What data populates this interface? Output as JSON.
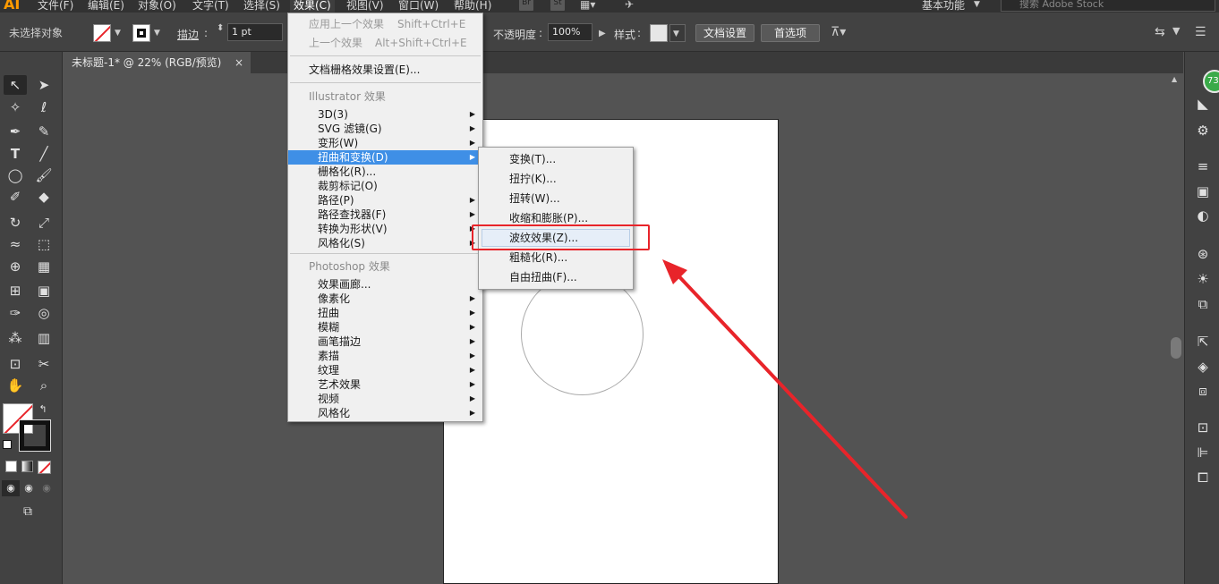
{
  "menubar": {
    "logo": "AI",
    "items": [
      "文件(F)",
      "编辑(E)",
      "对象(O)",
      "文字(T)",
      "选择(S)",
      "效果(C)",
      "视图(V)",
      "窗口(W)",
      "帮助(H)"
    ],
    "br": "Br",
    "st": "St",
    "workspace": "基本功能",
    "search_placeholder": "搜索 Adobe Stock"
  },
  "controlbar": {
    "selection_status": "未选择对象",
    "stroke_label": "描边",
    "stroke_value": "1 pt",
    "opacity_label": "不透明度",
    "opacity_value": "100%",
    "style_label": "样式",
    "doc_setup": "文档设置",
    "preferences": "首选项"
  },
  "tab": {
    "title": "未标题-1* @ 22% (RGB/预览)",
    "close": "×"
  },
  "effects_menu": {
    "apply_last": "应用上一个效果",
    "apply_last_shortcut": "Shift+Ctrl+E",
    "last_effect": "上一个效果",
    "last_effect_shortcut": "Alt+Shift+Ctrl+E",
    "raster_settings": "文档栅格效果设置(E)...",
    "illustrator_header": "Illustrator 效果",
    "illustrator_items": [
      "3D(3)",
      "SVG 滤镜(G)",
      "变形(W)",
      "扭曲和变换(D)",
      "栅格化(R)...",
      "裁剪标记(O)",
      "路径(P)",
      "路径查找器(F)",
      "转换为形状(V)",
      "风格化(S)"
    ],
    "photoshop_header": "Photoshop 效果",
    "photoshop_items": [
      "效果画廊...",
      "像素化",
      "扭曲",
      "模糊",
      "画笔描边",
      "素描",
      "纹理",
      "艺术效果",
      "视频",
      "风格化"
    ]
  },
  "submenu": {
    "items": [
      "变换(T)...",
      "扭拧(K)...",
      "扭转(W)...",
      "收缩和膨胀(P)...",
      "波纹效果(Z)...",
      "粗糙化(R)...",
      "自由扭曲(F)..."
    ]
  },
  "badge": "73",
  "colors": {
    "highlight": "#3f8fe6",
    "annotation": "#e8242a",
    "badge": "#3aaa49"
  }
}
